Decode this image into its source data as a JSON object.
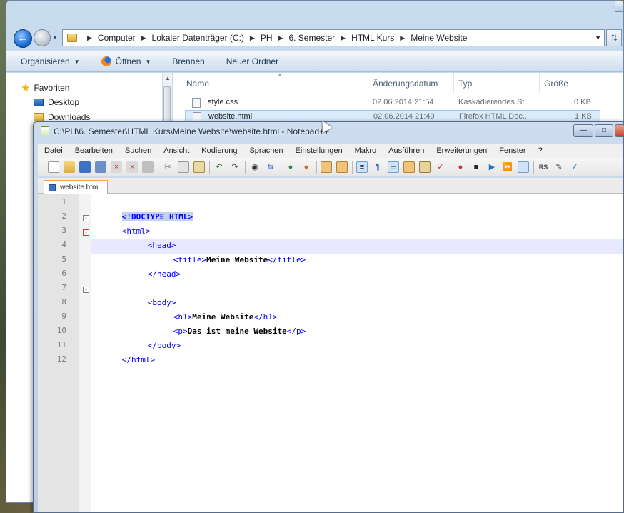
{
  "explorer": {
    "breadcrumb": [
      "Computer",
      "Lokaler Datenträger (C:)",
      "PH",
      "6. Semester",
      "HTML Kurs",
      "Meine Website"
    ],
    "commands": {
      "organize": "Organisieren",
      "open": "Öffnen",
      "burn": "Brennen",
      "new_folder": "Neuer Ordner"
    },
    "nav": {
      "favorites": "Favoriten",
      "desktop": "Desktop",
      "downloads": "Downloads"
    },
    "columns": {
      "name": "Name",
      "date": "Änderungsdatum",
      "type": "Typ",
      "size": "Größe"
    },
    "files": [
      {
        "name": "style.css",
        "date": "02.06.2014 21:54",
        "type": "Kaskadierendes St...",
        "size": "0 KB"
      },
      {
        "name": "website.html",
        "date": "02.06.2014 21:49",
        "type": "Firefox HTML Doc...",
        "size": "1 KB"
      }
    ]
  },
  "notepad": {
    "title": "C:\\PH\\6. Semester\\HTML Kurs\\Meine Website\\website.html - Notepad++",
    "menu": [
      "Datei",
      "Bearbeiten",
      "Suchen",
      "Ansicht",
      "Kodierung",
      "Sprachen",
      "Einstellungen",
      "Makro",
      "Ausführen",
      "Erweiterungen",
      "Fenster",
      "?"
    ],
    "tab_label": "website.html",
    "line_numbers": [
      "1",
      "2",
      "3",
      "4",
      "5",
      "6",
      "7",
      "8",
      "9",
      "10",
      "11",
      "12"
    ],
    "code": {
      "l1_doctype": "<!DOCTYPE HTML>",
      "l2_open": "<html>",
      "l3_open": "<head>",
      "l4_open": "<title>",
      "l4_text": "Meine Website",
      "l4_close": "</title>",
      "l5_close": "</head>",
      "l7_open": "<body>",
      "l8_open": "<h1>",
      "l8_text": "Meine Website",
      "l8_close": "</h1>",
      "l9_open": "<p>",
      "l9_text": "Das ist meine Website",
      "l9_close": "</p>",
      "l10_close": "</body>",
      "l11_close": "</html>"
    }
  },
  "colors": {
    "tag": "#0000ff",
    "text": "#000000",
    "current_line": "#e8e8ff",
    "tab_accent": "#f7a54a"
  }
}
